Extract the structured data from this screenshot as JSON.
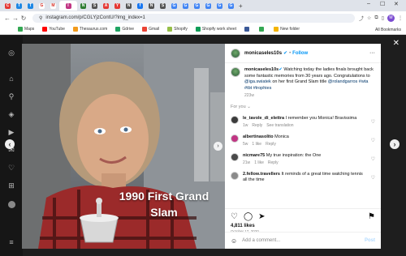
{
  "browser": {
    "tabs": [
      {
        "letter": "C",
        "color": "#e53935"
      },
      {
        "letter": "T",
        "color": "#1e88e5"
      },
      {
        "letter": "T",
        "color": "#1e88e5"
      },
      {
        "letter": "G",
        "color": "#ffffff"
      },
      {
        "letter": "M",
        "color": "#ffffff"
      },
      {
        "letter": "I",
        "color": "#c13584"
      },
      {
        "letter": "N",
        "color": "#2e7d32"
      },
      {
        "letter": "S",
        "color": "#555555"
      },
      {
        "letter": "A",
        "color": "#e53935"
      },
      {
        "letter": "Y",
        "color": "#e53935"
      },
      {
        "letter": "N",
        "color": "#555555"
      },
      {
        "letter": "f",
        "color": "#1877f2"
      },
      {
        "letter": "N",
        "color": "#555555"
      },
      {
        "letter": "S",
        "color": "#555555"
      },
      {
        "letter": "G",
        "color": "#4285f4"
      },
      {
        "letter": "G",
        "color": "#4285f4"
      },
      {
        "letter": "G",
        "color": "#4285f4"
      },
      {
        "letter": "G",
        "color": "#4285f4"
      },
      {
        "letter": "G",
        "color": "#4285f4"
      },
      {
        "letter": "G",
        "color": "#4285f4"
      }
    ],
    "active_tab_label": "I",
    "url": "instagram.com/p/CGLYjzContU/?img_index=1",
    "bookmarks": [
      {
        "label": "Maps",
        "color": "#34a853"
      },
      {
        "label": "YouTube",
        "color": "#ff0000"
      },
      {
        "label": "Thesaurus.com",
        "color": "#f29b1d"
      },
      {
        "label": "Gdrive",
        "color": "#1fa463"
      },
      {
        "label": "Gmail",
        "color": "#ea4335"
      },
      {
        "label": "Shopify",
        "color": "#96bf48"
      },
      {
        "label": "Shopify work sheet",
        "color": "#0f9d58"
      },
      {
        "label": "",
        "color": "#3b5998"
      },
      {
        "label": "",
        "color": "#34a853"
      },
      {
        "label": "New folder",
        "color": "#f4b400"
      }
    ],
    "all_bookmarks": "All Bookmarks",
    "profile_letter": "M"
  },
  "post": {
    "caption_overlay_line1": "1990 First Grand",
    "caption_overlay_line2": "Slam",
    "author": "monicaseles10s",
    "follow": "Follow",
    "description": {
      "author": "monicaseles10s",
      "text1": " Watching today the ladies finals brought back some fantastic memories from 30 years ago. Congratulations to ",
      "mention1": "@iga.swiatek",
      "text2": " on her first Grand Slam title ",
      "mention2": "@rolandgarros",
      "tags": " #wta #tbt #trophies",
      "time": "223w"
    },
    "for_you": "For you",
    "comments": [
      {
        "user": "le_tavole_di_elettra",
        "text": " I remember you Monica! Bravissima",
        "time": "1w",
        "likes": "",
        "reply": "Reply",
        "translation": "See translation",
        "avatar_color": "#3b3b3b"
      },
      {
        "user": "albertinasolito",
        "text": " Monica",
        "time": "5w",
        "likes": "1 like",
        "reply": "Reply",
        "translation": "",
        "avatar_color": "#c13584"
      },
      {
        "user": "nicmare75",
        "text": " My true inspiration: the One",
        "time": "21w",
        "likes": "1 like",
        "reply": "Reply",
        "translation": "",
        "avatar_color": "#4a4a4a"
      },
      {
        "user": "2.fellow.travellers",
        "text": " It reminds of a great time watching tennis all the time",
        "time": "",
        "likes": "",
        "reply": "",
        "translation": "",
        "avatar_color": "#8a8a8a"
      }
    ],
    "likes": "4,811 likes",
    "date": "October 17, 2020",
    "add_comment_placeholder": "Add a comment...",
    "post_label": "Post"
  }
}
